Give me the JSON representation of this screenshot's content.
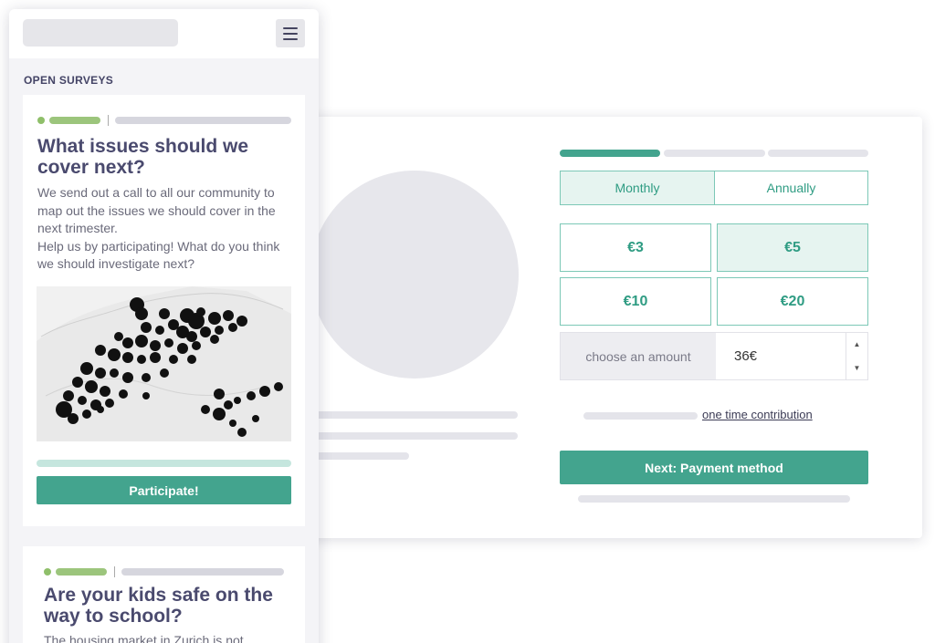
{
  "donation": {
    "frequency": {
      "options": [
        "Monthly",
        "Annually"
      ],
      "selected": "Monthly"
    },
    "amounts": [
      "€3",
      "€5",
      "€10",
      "€20"
    ],
    "selected_amount": "€5",
    "custom": {
      "label": "choose an amount",
      "value": "36€"
    },
    "one_time_link": "one time contribution",
    "next_button": "Next: Payment method",
    "step_progress": {
      "current_step": 1,
      "total_steps": 3
    }
  },
  "mobile": {
    "section_title": "OPEN SURVEYS",
    "surveys": [
      {
        "title": "What issues should we cover next?",
        "description": "We send out a call to all our community to map out the issues we should cover in the next trimester.\nHelp us by participating! What do you think we should investigate next?",
        "cta": "Participate!"
      },
      {
        "title": "Are your kids safe on the way to school?",
        "description": "The housing market in Zurich is not"
      }
    ]
  },
  "colors": {
    "accent": "#43a48e",
    "accent_light": "#e6f4f0",
    "title": "#4a4a6e",
    "tag_green": "#9cc57c",
    "placeholder": "#e6e6ea"
  },
  "icons": [
    "hamburger-menu-icon",
    "stepper-up-icon",
    "stepper-down-icon"
  ]
}
